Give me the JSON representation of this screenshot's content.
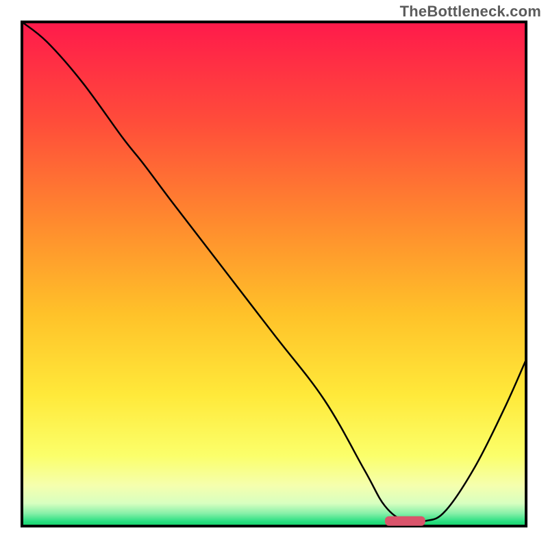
{
  "watermark": "TheBottleneck.com",
  "chart_data": {
    "type": "line",
    "title": "",
    "xlabel": "",
    "ylabel": "",
    "xlim": [
      0,
      100
    ],
    "ylim": [
      0,
      100
    ],
    "x": [
      0,
      5,
      12,
      20,
      24,
      30,
      40,
      50,
      60,
      68,
      72,
      76,
      80,
      84,
      90,
      96,
      100
    ],
    "values": [
      100,
      96,
      88,
      77,
      72,
      64,
      51,
      38,
      25,
      11,
      4,
      1,
      1,
      3,
      12,
      24,
      33
    ],
    "curve_description": "V-shaped bottleneck curve with minimum around x≈75–80",
    "optimal_marker": {
      "x_start": 72,
      "x_end": 80,
      "y": 1
    },
    "background": {
      "gradient_stops": [
        {
          "pos": 0.0,
          "color": "#ff1a4b"
        },
        {
          "pos": 0.2,
          "color": "#ff4d3a"
        },
        {
          "pos": 0.4,
          "color": "#ff8b2e"
        },
        {
          "pos": 0.58,
          "color": "#ffc229"
        },
        {
          "pos": 0.74,
          "color": "#ffe93a"
        },
        {
          "pos": 0.86,
          "color": "#fbff6a"
        },
        {
          "pos": 0.92,
          "color": "#f5ffae"
        },
        {
          "pos": 0.955,
          "color": "#d8ffc0"
        },
        {
          "pos": 0.975,
          "color": "#86f0a8"
        },
        {
          "pos": 0.99,
          "color": "#2ee083"
        },
        {
          "pos": 1.0,
          "color": "#10d268"
        }
      ]
    },
    "frame_color": "#000000",
    "marker_color": "#d9546b"
  }
}
